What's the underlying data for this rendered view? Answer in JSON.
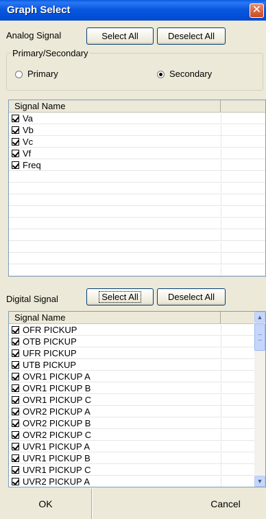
{
  "window": {
    "title": "Graph Select",
    "close_glyph": "✕"
  },
  "analog": {
    "label": "Analog Signal",
    "select_all": "Select All",
    "deselect_all": "Deselect All",
    "group_title": "Primary/Secondary",
    "radio_primary": "Primary",
    "radio_secondary": "Secondary",
    "selected_radio": "Secondary",
    "list_header": "Signal Name",
    "items": [
      {
        "label": "Va",
        "checked": true
      },
      {
        "label": "Vb",
        "checked": true
      },
      {
        "label": "Vc",
        "checked": true
      },
      {
        "label": "Vf",
        "checked": true
      },
      {
        "label": "Freq",
        "checked": true
      }
    ]
  },
  "digital": {
    "label": "Digital Signal",
    "select_all": "Select All",
    "deselect_all": "Deselect All",
    "list_header": "Signal Name",
    "items": [
      {
        "label": "OFR PICKUP",
        "checked": true
      },
      {
        "label": "OTB PICKUP",
        "checked": true
      },
      {
        "label": "UFR PICKUP",
        "checked": true
      },
      {
        "label": "UTB PICKUP",
        "checked": true
      },
      {
        "label": "OVR1 PICKUP A",
        "checked": true
      },
      {
        "label": "OVR1 PICKUP B",
        "checked": true
      },
      {
        "label": "OVR1 PICKUP C",
        "checked": true
      },
      {
        "label": "OVR2 PICKUP A",
        "checked": true
      },
      {
        "label": "OVR2 PICKUP B",
        "checked": true
      },
      {
        "label": "OVR2 PICKUP C",
        "checked": true
      },
      {
        "label": "UVR1 PICKUP A",
        "checked": true
      },
      {
        "label": "UVR1 PICKUP B",
        "checked": true
      },
      {
        "label": "UVR1 PICKUP C",
        "checked": true
      },
      {
        "label": "UVR2 PICKUP A",
        "checked": true
      }
    ]
  },
  "footer": {
    "ok": "OK",
    "cancel": "Cancel"
  },
  "icons": {
    "scroll_up": "scroll-up-arrow-icon",
    "scroll_down": "scroll-down-arrow-icon",
    "checkbox": "checkbox-checked-icon"
  },
  "colors": {
    "titlebar": "#0b58e0",
    "face": "#ece9d8",
    "list_border": "#7f9db9"
  }
}
